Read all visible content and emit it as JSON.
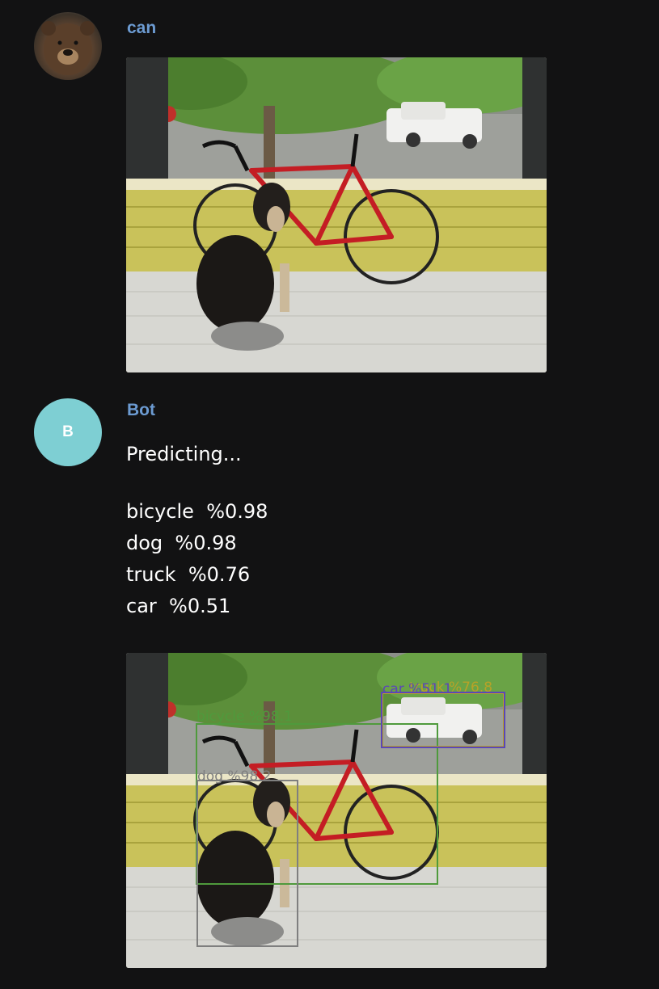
{
  "messages": {
    "user": {
      "author": "can",
      "avatar_icon": "bear-avatar-icon"
    },
    "bot": {
      "author": "Bot",
      "avatar_initial": "B",
      "status": "Predicting...",
      "predictions": [
        {
          "label": "bicycle",
          "score": "%0.98"
        },
        {
          "label": "dog",
          "score": "%0.98"
        },
        {
          "label": "truck",
          "score": "%0.76"
        },
        {
          "label": "car",
          "score": "%0.51"
        }
      ],
      "detections": [
        {
          "label": "bicycle %98.1",
          "color": "#4f9a3c"
        },
        {
          "label": "dog %98.2",
          "color": "#7f7f7f"
        },
        {
          "label": "car %51.1",
          "color": "#5b46b8"
        },
        {
          "label": "truck %76.8",
          "color": "#b7a228"
        }
      ]
    }
  },
  "colors": {
    "background": "#121213",
    "author_name": "#6c9bd2",
    "bot_avatar": "#7ecfd3"
  }
}
